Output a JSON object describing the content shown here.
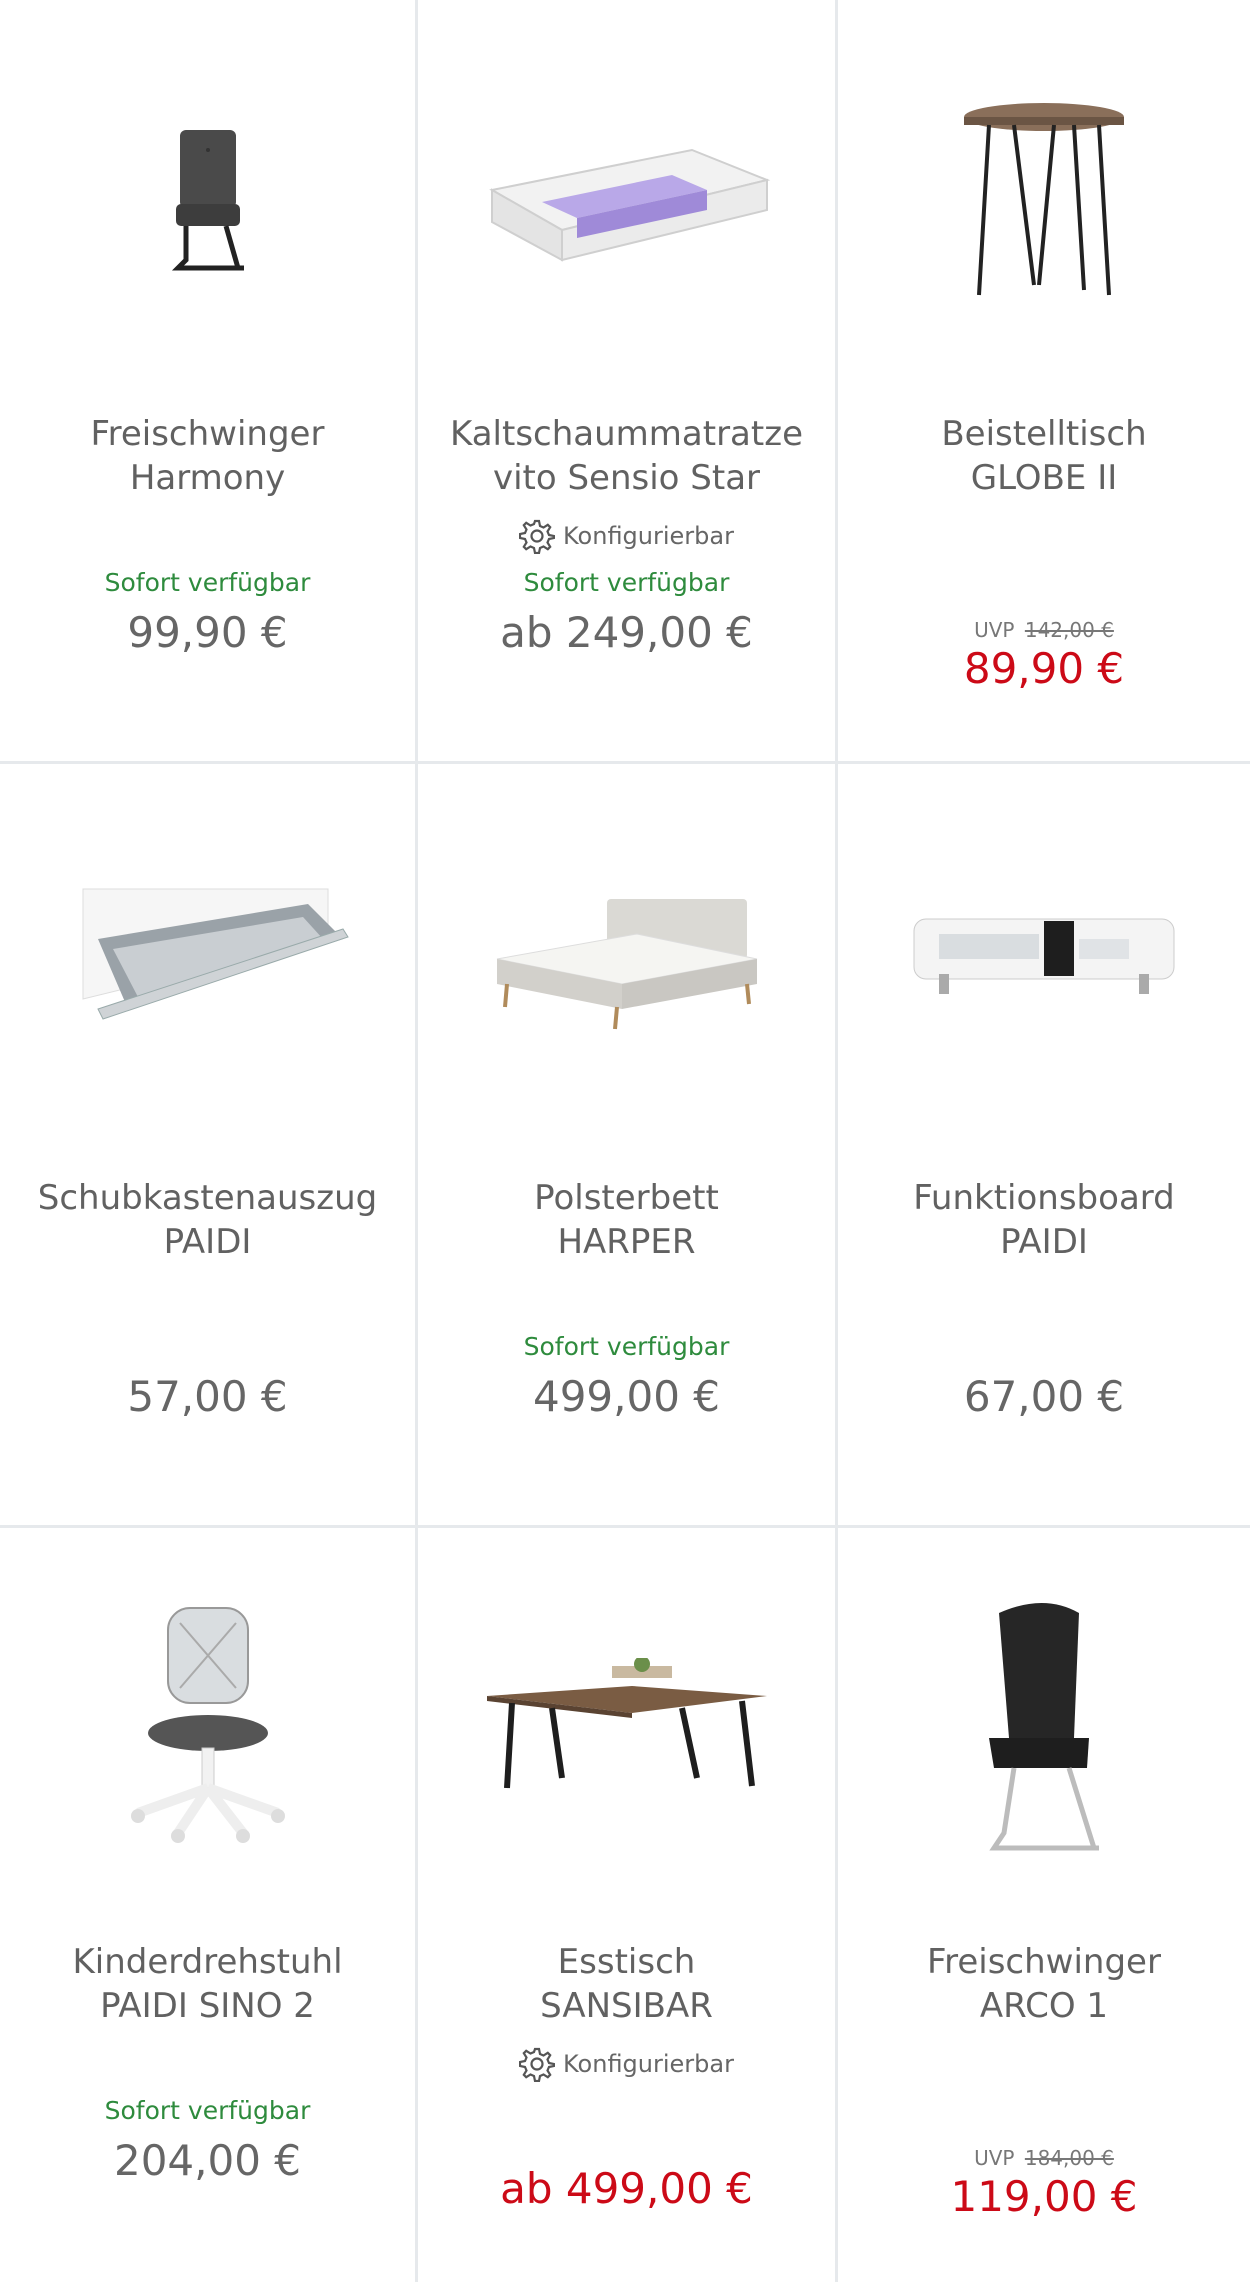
{
  "products": [
    {
      "title_line1": "Freischwinger",
      "title_line2": "Harmony",
      "availability": "Sofort verfügbar",
      "price": "99,90 €"
    },
    {
      "title_line1": "Kaltschaummatratze",
      "title_line2": "vito Sensio Star",
      "config_label": "Konfigurierbar",
      "availability": "Sofort verfügbar",
      "price": "ab 249,00 €"
    },
    {
      "title_line1": "Beistelltisch",
      "title_line2": "GLOBE II",
      "uvp_label": "UVP",
      "uvp_price": "142,00 €",
      "price": "89,90 €"
    },
    {
      "title_line1": "Schubkastenauszug",
      "title_line2": "PAIDI",
      "price": "57,00 €"
    },
    {
      "title_line1": "Polsterbett",
      "title_line2": "HARPER",
      "availability": "Sofort verfügbar",
      "price": "499,00 €"
    },
    {
      "title_line1": "Funktionsboard",
      "title_line2": "PAIDI",
      "price": "67,00 €"
    },
    {
      "title_line1": "Kinderdrehstuhl",
      "title_line2": "PAIDI SINO 2",
      "availability": "Sofort verfügbar",
      "price": "204,00 €"
    },
    {
      "title_line1": "Esstisch",
      "title_line2": "SANSIBAR",
      "config_label": "Konfigurierbar",
      "price": "ab 499,00 €"
    },
    {
      "title_line1": "Freischwinger",
      "title_line2": "ARCO 1",
      "uvp_label": "UVP",
      "uvp_price": "184,00 €",
      "price": "119,00 €"
    }
  ],
  "colors": {
    "availability": "#2e8b3d",
    "sale_price": "#cc0a17",
    "divider": "#e6e9ec"
  }
}
